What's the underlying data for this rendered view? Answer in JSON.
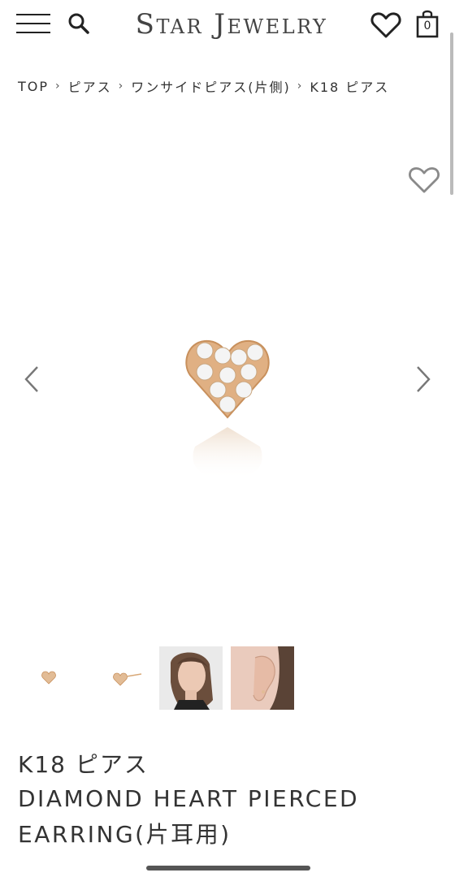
{
  "header": {
    "logo": "Star Jewelry",
    "cart_count": "0",
    "icons": {
      "menu": "hamburger-menu-icon",
      "search": "search-icon",
      "wishlist": "heart-outline-icon",
      "cart": "shopping-bag-icon"
    }
  },
  "breadcrumb": [
    "TOP",
    "ピアス",
    "ワンサイドピアス(片側)",
    "K18 ピアス"
  ],
  "product": {
    "title_jp": "K18 ピアス",
    "title_en": "DIAMOND HEART PIERCED EARRING(片耳用)",
    "image_alt_icon": "diamond-heart-earring-image"
  },
  "thumbnails": [
    "thumbnail-heart-front",
    "thumbnail-heart-side",
    "thumbnail-model-portrait",
    "thumbnail-ear-closeup"
  ],
  "colors": {
    "gold": "#d9a874",
    "text": "#333333",
    "icon_gray": "#8a8a8a"
  }
}
